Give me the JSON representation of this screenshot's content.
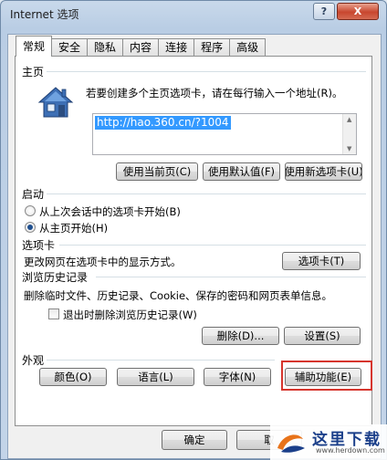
{
  "window": {
    "title": "Internet 选项",
    "help_label": "?",
    "close_label": "X"
  },
  "tabs": [
    {
      "label": "常规",
      "active": true
    },
    {
      "label": "安全"
    },
    {
      "label": "隐私"
    },
    {
      "label": "内容"
    },
    {
      "label": "连接"
    },
    {
      "label": "程序"
    },
    {
      "label": "高级"
    }
  ],
  "homepage": {
    "section_title": "主页",
    "description": "若要创建多个主页选项卡，请在每行输入一个地址(R)。",
    "url_value": "http://hao.360.cn/?1004",
    "buttons": {
      "use_current": "使用当前页(C)",
      "use_default": "使用默认值(F)",
      "use_new_tab": "使用新选项卡(U)"
    }
  },
  "startup": {
    "section_title": "启动",
    "options": [
      {
        "label": "从上次会话中的选项卡开始(B)",
        "checked": false
      },
      {
        "label": "从主页开始(H)",
        "checked": true
      }
    ]
  },
  "tabs_section": {
    "section_title": "选项卡",
    "description": "更改网页在选项卡中的显示方式。",
    "button": "选项卡(T)"
  },
  "history": {
    "section_title": "浏览历史记录",
    "description": "删除临时文件、历史记录、Cookie、保存的密码和网页表单信息。",
    "checkbox_label": "退出时删除浏览历史记录(W)",
    "checkbox_checked": false,
    "delete_button": "删除(D)...",
    "settings_button": "设置(S)"
  },
  "appearance": {
    "section_title": "外观",
    "buttons": {
      "colors": "颜色(O)",
      "languages": "语言(L)",
      "fonts": "字体(N)",
      "accessibility": "辅助功能(E)"
    }
  },
  "footer": {
    "ok": "确定",
    "cancel": "取"
  },
  "watermark": {
    "name": "这里下载",
    "url": "www.herdown.com"
  },
  "colors": {
    "highlight_border": "#d6352d",
    "selection": "#3399ff"
  }
}
